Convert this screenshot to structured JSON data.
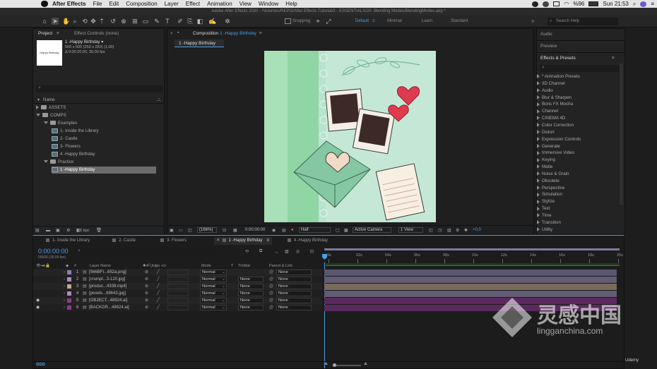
{
  "menubar": {
    "app": "After Effects",
    "items": [
      "File",
      "Edit",
      "Composition",
      "Layer",
      "Effect",
      "Animation",
      "View",
      "Window",
      "Help"
    ],
    "battery": "%96",
    "clock": "Sun 21:53"
  },
  "titlebar": "Adobe After Effects 2020 - /Volumes/REPO/After Effects Tutorial/2 - ESSENTIALS/20- Blending Modes/BlendingModes.aep *",
  "toolbar": {
    "snapping": "Snapping",
    "workspaces": [
      "Default",
      "Minimal",
      "Learn",
      "Standard"
    ],
    "search_placeholder": "Search Help"
  },
  "project": {
    "tab": "Project",
    "tab2": "Effect Controls (none)",
    "comp_name": "1 -Happy Birthday ▾",
    "comp_info1": "500 x 500 (250 x 250) (1,00)",
    "comp_info2": "Δ 0:00:20:00, 30,00 fps",
    "thumb_text": "Happy Birthday",
    "search_placeholder": "",
    "col_name": "Name",
    "items": [
      {
        "label": "ASSETS",
        "kind": "folder",
        "indent": 0,
        "open": false
      },
      {
        "label": "COMPS",
        "kind": "folder",
        "indent": 0,
        "open": true
      },
      {
        "label": "Examples",
        "kind": "folder",
        "indent": 1,
        "open": true
      },
      {
        "label": "1- Inside the Library",
        "kind": "comp",
        "indent": 2
      },
      {
        "label": "2- Castle",
        "kind": "comp",
        "indent": 2
      },
      {
        "label": "3- Flowers",
        "kind": "comp",
        "indent": 2
      },
      {
        "label": "4 -Happy Birthday",
        "kind": "comp",
        "indent": 2
      },
      {
        "label": "Practice",
        "kind": "folder",
        "indent": 1,
        "open": true
      },
      {
        "label": "1 -Happy Birthday",
        "kind": "comp",
        "indent": 2,
        "selected": true
      }
    ],
    "bpc": "16 bpc"
  },
  "composition": {
    "tab": "Composition",
    "tab_comp": "1 -Happy Birthday",
    "subtab": "1 -Happy Birthday",
    "zoom": "(166%)",
    "timecode": "0:00:00:00",
    "resolution": "Half",
    "camera": "Active Camera",
    "views": "1 View",
    "exposure": "+0,0"
  },
  "right": {
    "audio": "Audio",
    "preview": "Preview",
    "effects_title": "Effects & Presets",
    "search_placeholder": "",
    "categories": [
      "* Animation Presets",
      "3D Channel",
      "Audio",
      "Blur & Sharpen",
      "Boris FX Mocha",
      "Channel",
      "CINEMA 4D",
      "Color Correction",
      "Distort",
      "Expression Controls",
      "Generate",
      "Immersive Video",
      "Keying",
      "Matte",
      "Noise & Grain",
      "Obsolete",
      "Perspective",
      "Simulation",
      "Stylize",
      "Text",
      "Time",
      "Transition",
      "Utility"
    ]
  },
  "timeline": {
    "tabs": [
      "1- Inside the Library",
      "2- Castle",
      "3- Flowers",
      "1 -Happy Birthday",
      "4 -Happy Birthday"
    ],
    "timecode": "0:00:00:00",
    "frames": "00000 (30.00 fps)",
    "headers": {
      "layer_name": "Layer Name",
      "mode": "Mode",
      "t": "T",
      "trkmat": "TrkMat",
      "parent": "Parent & Link"
    },
    "ruler": [
      "0s",
      "02s",
      "04s",
      "06s",
      "08s",
      "10s",
      "12s",
      "14s",
      "16s",
      "18s",
      "20s"
    ],
    "layers": [
      {
        "num": "1",
        "name": "[566BFI...652a.png]",
        "mode": "Normal",
        "trkmat": "",
        "parent": "None",
        "color": "#8c7fb8",
        "bar": "#5b5670",
        "eye": false
      },
      {
        "num": "2",
        "name": "[crumpl...3-120.jpg]",
        "mode": "Normal",
        "trkmat": "None",
        "parent": "None",
        "color": "#a88fbf",
        "bar": "#625c74",
        "eye": false
      },
      {
        "num": "3",
        "name": "[produc...4339.mp4]",
        "mode": "Normal",
        "trkmat": "None",
        "parent": "None",
        "color": "#c7a889",
        "bar": "#7a6a5b",
        "eye": false
      },
      {
        "num": "4",
        "name": "[pexels...89643.jpg]",
        "mode": "Normal",
        "trkmat": "None",
        "parent": "None",
        "color": "#a88fbf",
        "bar": "#625c74",
        "eye": false
      },
      {
        "num": "5",
        "name": "[OBJECT...48924.ai]",
        "mode": "Normal",
        "trkmat": "None",
        "parent": "None",
        "color": "#8e3a8e",
        "bar": "#5a2a5e",
        "eye": true
      },
      {
        "num": "6",
        "name": "[BACKGR...48924.ai]",
        "mode": "Normal",
        "trkmat": "None",
        "parent": "None",
        "color": "#8e3a8e",
        "bar": "#5a2a5e",
        "eye": true
      }
    ]
  },
  "watermark": {
    "brand": "灵感中国",
    "url": "lingganchina.com",
    "udemy": "Udemy"
  }
}
